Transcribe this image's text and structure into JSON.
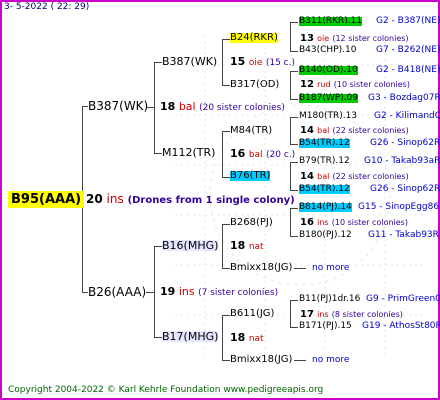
{
  "date": "3- 5-2022 ( 22: 29)",
  "root": "B95(AAA)",
  "root_num": "20",
  "root_sfx": "ins",
  "root_note": "(Drones from 1 single colony)",
  "n1": "B387(WK)",
  "n1_num": "18",
  "n1_sfx": "bal",
  "n1_note": "(20 sister colonies)",
  "n1a": "B387(WK)",
  "n1a_num": "15",
  "n1a_sfx": "oie",
  "n1a_note": "(15 c.)",
  "n1a1": "B24(RKR)",
  "n1a1_num": "13",
  "n1a1_sfx": "oie",
  "n1a1_note": "(12 sister colonies)",
  "n1a2": "B317(OD)",
  "n1a2_num": "12",
  "n1a2_sfx": "rud",
  "n1a2_note": "(10 sister colonies)",
  "n1b": "M112(TR)",
  "n1b_num": "16",
  "n1b_sfx": "bal",
  "n1b_note": "(20 c.)",
  "n1b1": "M84(TR)",
  "n1b1_num": "14",
  "n1b1_sfx": "bal",
  "n1b1_note": "(22 sister colonies)",
  "n1b2": "B76(TR)",
  "n1b2_num": "14",
  "n1b2_sfx": "bal",
  "n1b2_note": "(22 sister colonies)",
  "n2": "B26(AAA)",
  "n2_num": "19",
  "n2_sfx": "ins",
  "n2_note": "(7 sister colonies)",
  "n2a": "B16(MHG)",
  "n2a_num": "18",
  "n2a_sfx": "nat",
  "n2a1": "B268(PJ)",
  "n2a1_num": "16",
  "n2a1_sfx": "ins",
  "n2a1_note": "(10 sister colonies)",
  "n2a2": "Bmixx18(JG)",
  "n2a2_more": "no more",
  "n2b": "B17(MHG)",
  "n2b_num": "18",
  "n2b_sfx": "nat",
  "n2b1": "B611(JG)",
  "n2b1_num": "17",
  "n2b1_sfx": "ins",
  "n2b1_note": "(8 sister colonies)",
  "n2b2": "Bmixx18(JG)",
  "n2b2_more": "no more",
  "r1": "B311(RKR).11",
  "r1b": "G2 - B387(NE)",
  "r2": "B43(CHP).10",
  "r2b": "G7 - B262(NE)",
  "r3": "B140(OD).10",
  "r3b": "G2 - B418(NE)",
  "r4": "B187(WP).09",
  "r4b": "G3 - Bozdag07R",
  "r5": "M180(TR).13",
  "r5b": "G2 - KilimandQ",
  "r6": "B54(TR).12",
  "r6b": "G26 - Sinop62R",
  "r7": "B79(TR).12",
  "r7b": "G10 - Takab93aR",
  "r8": "B54(TR).12",
  "r8b": "G26 - Sinop62R",
  "r9": "B814(PJ).14",
  "r9b": "G15 - SinopEgg86R",
  "r10": "B180(PJ).12",
  "r10b": "G11 - Takab93R",
  "r11": "B11(PJ)1dr.16",
  "r11b": "G9 - PrimGreen00",
  "r12": "B171(PJ).15",
  "r12b": "G19 - AthosSt80R",
  "footer": "Copyright 2004-2022 © Karl Kehrle Foundation    www.pedigreeapis.org",
  "colors": {
    "frame": "#cc00cc",
    "root_bg": "#ffff00",
    "green": "#00cc00",
    "cyan": "#00ccff",
    "red": "#cc0000"
  }
}
